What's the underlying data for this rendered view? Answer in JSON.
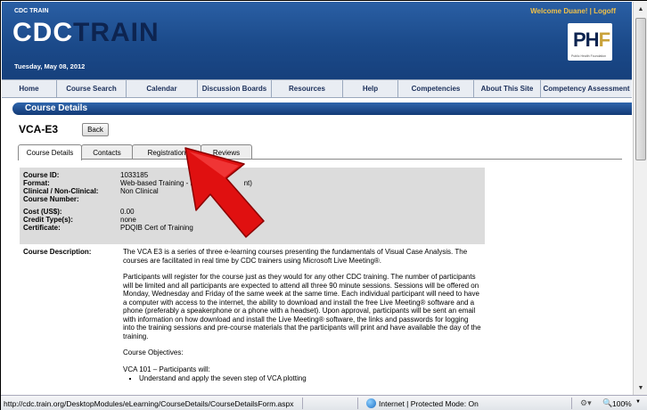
{
  "header": {
    "brand_small": "CDC TRAIN",
    "logo_part1": "CDC",
    "logo_part2": "TR",
    "logo_part3": "AIN",
    "date": "Tuesday, May 08, 2012",
    "welcome": "Welcome Duane!",
    "logoff": "Logoff",
    "separator": " | ",
    "partner_logo": "PHF",
    "partner_tag": "Public Health Foundation"
  },
  "nav": [
    {
      "label": "Home"
    },
    {
      "label": "Course Search"
    },
    {
      "label": "Calendar"
    },
    {
      "label": "Discussion Boards"
    },
    {
      "label": "Resources"
    },
    {
      "label": "Help"
    },
    {
      "label": "Competencies"
    },
    {
      "label": "About This Site"
    },
    {
      "label": "Competency Assessment"
    }
  ],
  "section": {
    "title": "Course Details"
  },
  "course": {
    "code": "VCA-E3",
    "back_label": "Back"
  },
  "tabs": [
    {
      "label": "Course Details",
      "active": true
    },
    {
      "label": "Contacts",
      "active": false
    },
    {
      "label": "Registration",
      "active": false
    },
    {
      "label": "Reviews",
      "active": false
    }
  ],
  "details": [
    {
      "label": "Course ID:",
      "value": "1033185"
    },
    {
      "label": "Format:",
      "value": "Web-based Training - Fi                        nt)"
    },
    {
      "label": "Clinical / Non-Clinical:",
      "value": "Non Clinical"
    },
    {
      "label": "Course Number:",
      "value": ""
    },
    {
      "label": "Cost (US$):",
      "value": "0.00"
    },
    {
      "label": "Credit Type(s):",
      "value": "none"
    },
    {
      "label": "Certificate:",
      "value": "PDQIB Cert of Training"
    }
  ],
  "description": {
    "label": "Course Description:",
    "p1": "The VCA E3 is a series of three e-learning courses presenting the fundamentals of Visual Case Analysis. The courses are facilitated in real time by CDC trainers using Microsoft Live Meeting®.",
    "p2": "Participants will register for the course just as they would for any other CDC training. The number of participants will be limited and all participants are expected to attend all three 90 minute sessions. Sessions will be offered on Monday, Wednesday and Friday of the same week at the same time. Each individual participant will need to have a computer with access to the internet, the ability to download and install the free Live Meeting® software and a phone (preferably a speakerphone or a phone with a headset). Upon approval, participants will be sent an email with information on how download and install the Live Meeting® software, the links and passwords for logging into the training sessions and pre-course materials that the participants will print and have available the day of the training.",
    "p3": "Course Objectives:",
    "p4": "VCA 101 – Participants will:",
    "bullet1": "Understand and apply the seven step of VCA plotting"
  },
  "status": {
    "url": "http://cdc.train.org/DesktopModules/eLearning/CourseDetails/CourseDetailsForm.aspx",
    "zone": "Internet | Protected Mode: On",
    "zoom": "100%"
  },
  "colors": {
    "header_blue": "#1b4a8a",
    "nav_bg": "#e9edf3",
    "welcome_gold": "#f0c14a",
    "arrow_red": "#e01010"
  },
  "icons": {
    "scroll_up": "scroll-up-arrow-icon",
    "scroll_down": "scroll-down-arrow-icon",
    "globe": "globe-icon",
    "zoom": "magnifier-icon",
    "pointer": "red-arrow-icon"
  }
}
